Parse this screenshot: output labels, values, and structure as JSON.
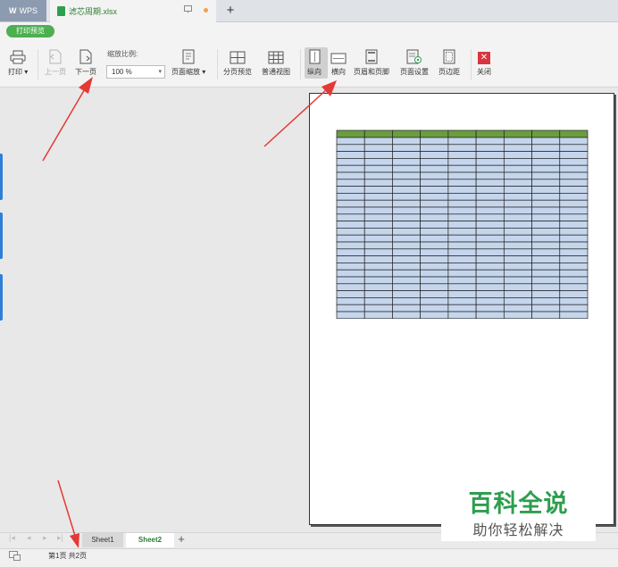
{
  "titlebar": {
    "app_name": "WPS",
    "file_name": "滤芯周期.xlsx",
    "new_tab": "+"
  },
  "toolbar": {
    "print_preview_badge": "打印预览",
    "print": "打印",
    "prev_page": "上一页",
    "next_page": "下一页",
    "zoom_label": "缩放比例:",
    "zoom_value": "100 %",
    "page_zoom": "页面缩放",
    "page_break_preview": "分页预览",
    "normal_view": "普通视图",
    "portrait": "纵向",
    "landscape": "横向",
    "header_footer": "页眉和页脚",
    "page_setup": "页面设置",
    "margins": "页边距",
    "close": "关闭"
  },
  "sheets": {
    "tabs": [
      "Sheet1",
      "Sheet2"
    ],
    "active": "Sheet2",
    "add": "+"
  },
  "status": {
    "page_info": "第1页 共2页"
  },
  "watermark": {
    "title": "百科全说",
    "subtitle": "助你轻松解决"
  },
  "preview_table": {
    "columns": 9,
    "rows": 26,
    "header_color": "#6a9d3f",
    "cell_color": "#c5d5ec"
  },
  "colors": {
    "accent_green": "#4caf50",
    "arrow_red": "#e53935",
    "close_red": "#d9363e"
  }
}
